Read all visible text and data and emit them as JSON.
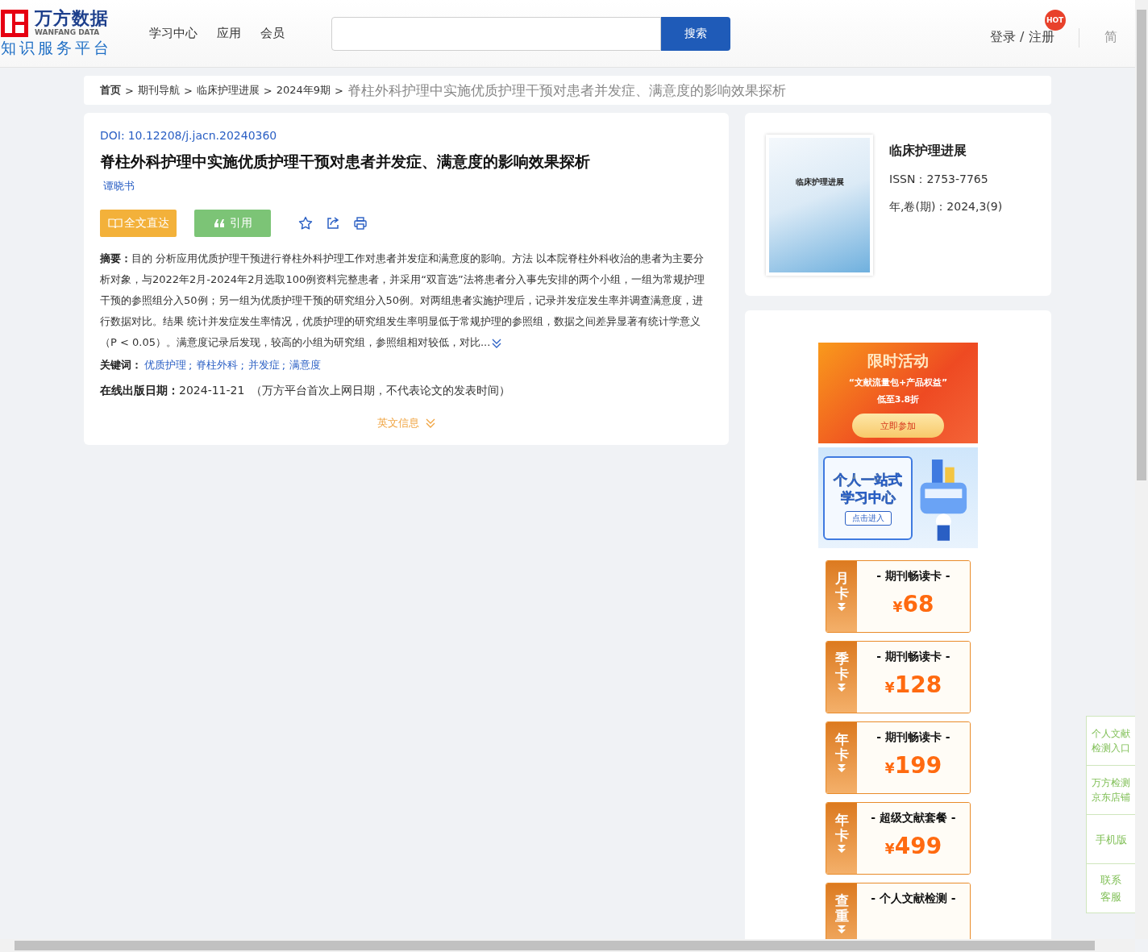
{
  "header": {
    "logo": {
      "name": "万方数据",
      "latin": "WANFANG DATA",
      "tagline": "知识服务平台"
    },
    "nav": [
      {
        "label": "学习中心"
      },
      {
        "label": "应用"
      },
      {
        "label": "会员"
      }
    ],
    "search": {
      "button": "搜索"
    },
    "login": "登录 / 注册",
    "hot_badge": "HOT",
    "lang": "简"
  },
  "breadcrumb_separator": ">",
  "breadcrumb": [
    {
      "label": "首页",
      "current": false
    },
    {
      "label": "期刊导航",
      "current": false
    },
    {
      "label": "临床护理进展",
      "current": false
    },
    {
      "label": "2024年9期",
      "current": false
    },
    {
      "label": "脊柱外科护理中实施优质护理干预对患者并发症、满意度的影响效果探析",
      "current": true
    }
  ],
  "article": {
    "doi_label": "DOI:",
    "doi": "10.12208/j.jacn.20240360",
    "title": "脊柱外科护理中实施优质护理干预对患者并发症、满意度的影响效果探析",
    "authors": [
      "谭晓书"
    ],
    "actions": [
      {
        "kind": "fulltext",
        "label": "全文直达"
      },
      {
        "kind": "cite",
        "label": "引用"
      }
    ],
    "tools": [
      {
        "kind": "favorite"
      },
      {
        "kind": "share"
      },
      {
        "kind": "print"
      }
    ],
    "abstract": {
      "label": "摘要：",
      "text": "目的 分析应用优质护理干预进行脊柱外科护理工作对患者并发症和满意度的影响。方法 以本院脊柱外科收治的患者为主要分析对象，与2022年2月-2024年2月选取100例资料完整患者，并采用“双盲选”法将患者分入事先安排的两个小组，一组为常规护理干预的参照组分入50例；另一组为优质护理干预的研究组分入50例。对两组患者实施护理后，记录并发症发生率并调查满意度，进行数据对比。结果 统计并发症发生率情况，优质护理的研究组发生率明显低于常规护理的参照组，数据之间差异显著有统计学意义（P < 0.05）。满意度记录后发现，较高的小组为研究组，参照组相对较低，对比..."
    },
    "keywords": {
      "label": "关键词：",
      "separator": ";",
      "items": [
        "优质护理",
        "脊柱外科",
        "并发症",
        "满意度"
      ]
    },
    "online_date": {
      "label": "在线出版日期：",
      "value": "2024-11-21",
      "note": "（万方平台首次上网日期，不代表论文的发表时间）"
    },
    "english_toggle": "英文信息"
  },
  "journal": {
    "cover_title": "临床护理进展",
    "name": "临床护理进展",
    "issn_label": "ISSN：",
    "issn": "2753-7765",
    "issue_label": "年,卷(期)：",
    "issue": "2024,3(9)"
  },
  "promo": {
    "title": "限时活动",
    "subtitle": "“文献流量包+产品权益”",
    "discount": "低至3.8折",
    "button": "立即参加"
  },
  "study_banner": {
    "lines": [
      "个人一站式",
      "学习中心"
    ],
    "button": "点击进入"
  },
  "cards": [
    {
      "tag": "月卡",
      "title": "- 期刊畅读卡 -",
      "currency": "¥",
      "price": "68"
    },
    {
      "tag": "季卡",
      "title": "- 期刊畅读卡 -",
      "currency": "¥",
      "price": "128"
    },
    {
      "tag": "年卡",
      "title": "- 期刊畅读卡 -",
      "currency": "¥",
      "price": "199"
    },
    {
      "tag": "年卡",
      "title": "- 超级文献套餐 -",
      "currency": "¥",
      "price": "499"
    },
    {
      "tag": "查重",
      "title": "- 个人文献检测 -"
    }
  ],
  "side_panel": [
    {
      "lines": [
        "个人文献",
        "检测入口"
      ]
    },
    {
      "lines": [
        "万方检测",
        "京东店铺"
      ]
    },
    {
      "lines": [
        "手机版"
      ]
    },
    {
      "lines": [
        "联系",
        "客服"
      ]
    }
  ]
}
